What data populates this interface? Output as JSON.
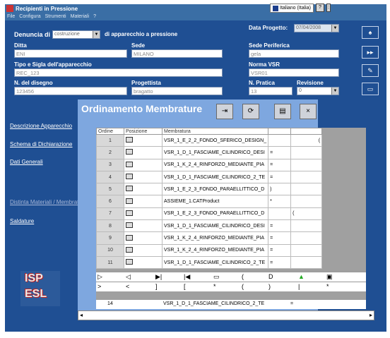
{
  "window": {
    "title": "Recipienti in Pressione",
    "language": "Italiano (Italia)"
  },
  "menu": [
    "File",
    "Configura",
    "Strumenti",
    "Materiali",
    "?"
  ],
  "form": {
    "denuncia_label": "Denuncia di",
    "denuncia_value": "costruzione",
    "apparecchio_label": "di apparecchio a pressione",
    "data_progetto_label": "Data Progetto:",
    "data_progetto_value": "07/04/2008",
    "ditta_label": "Ditta",
    "ditta_value": "ENI",
    "sede_label": "Sede",
    "sede_value": "MILANO",
    "sede_periferica_label": "Sede Periferica",
    "sede_periferica_value": "gela",
    "tipo_label": "Tipo e Sigla dell'apparecchio",
    "tipo_value": "REC_123",
    "norma_label": "Norma VSR",
    "norma_value": "VSR01",
    "disegno_label": "N. del disegno",
    "disegno_value": "123456",
    "progettista_label": "Progettista",
    "progettista_value": "bragatto",
    "pratica_label": "N. Pratica",
    "pratica_value": "13",
    "revisione_label": "Revisione",
    "revisione_value": "0"
  },
  "side_links": [
    "Descrizione Apparecchio",
    "Schema di Dichiarazione",
    "Dati Generali",
    "Distinta Materiali / Membratu",
    "Saldature"
  ],
  "logo": {
    "line1": "ISP",
    "line2": "ESL"
  },
  "dialog": {
    "title": "Ordinamento Membrature",
    "close_label": "×"
  },
  "grid": {
    "columns": [
      "Ordine",
      "Posizione",
      "Membratura"
    ],
    "rows": [
      {
        "order": "1",
        "name": "VSR_1_E_2_2_FONDO_SFERICO_DESIGN_",
        "mark": "("
      },
      {
        "order": "2",
        "name": "VSR_1_D_1_FASCIAME_CILINDRICO_DESI",
        "mark": "="
      },
      {
        "order": "3",
        "name": "VSR_1_K_2_4_RINFORZO_MEDIANTE_PIA",
        "mark": "="
      },
      {
        "order": "4",
        "name": "VSR_1_D_1_FASCIAME_CILINDRICO_2_TE",
        "mark": "="
      },
      {
        "order": "5",
        "name": "VSR_1_E_2_3_FONDO_PARAELLITTICO_D",
        "mark": ")"
      },
      {
        "order": "6",
        "name": "ASSIEME_1.CATProduct",
        "mark": "*"
      },
      {
        "order": "7",
        "name": "VSR_1_E_2_3_FONDO_PARAELLITTICO_D",
        "mark": "("
      },
      {
        "order": "8",
        "name": "VSR_1_D_1_FASCIAME_CILINDRICO_DESI",
        "mark": "="
      },
      {
        "order": "9",
        "name": "VSR_1_K_2_4_RINFORZO_MEDIANTE_PIA",
        "mark": "="
      },
      {
        "order": "10",
        "name": "VSR_1_K_2_4_RINFORZO_MEDIANTE_PIA",
        "mark": "="
      },
      {
        "order": "11",
        "name": "VSR_1_D_1_FASCIAME_CILINDRICO_2_TE",
        "mark": "="
      }
    ],
    "last_row": {
      "order": "14",
      "name": "VSR_1_D_1_FASCIAME_CILINDRICO_2_TE",
      "mark": "="
    }
  },
  "toolbar_symbols": [
    ">",
    "<",
    "]",
    "[",
    "*",
    "(",
    ")",
    "|",
    "*"
  ]
}
